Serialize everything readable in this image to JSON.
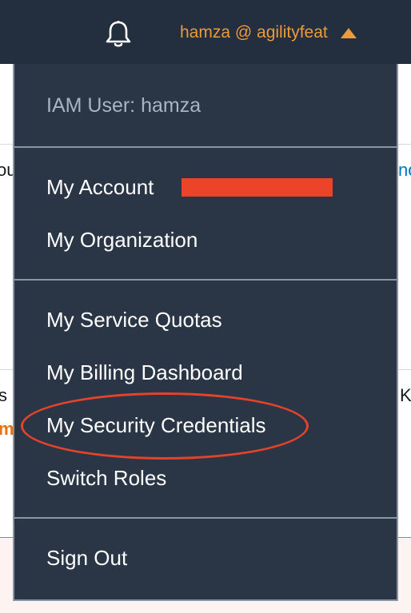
{
  "navbar": {
    "user_label": "hamza @ agilityfeat",
    "bell_icon": "bell-icon",
    "caret_icon": "caret-up-icon",
    "accent_color": "#ec9a3c",
    "background_color": "#232f3e"
  },
  "background_fragments": {
    "left_1": "ou",
    "right_1": "no",
    "left_2": "s",
    "right_2": "K",
    "left_orange": "m"
  },
  "dropdown": {
    "header": "IAM User: hamza",
    "items": [
      {
        "label": "My Account",
        "redacted": true
      },
      {
        "label": "My Organization"
      },
      {
        "label": "My Service Quotas"
      },
      {
        "label": "My Billing Dashboard"
      },
      {
        "label": "My Security Credentials",
        "highlighted": true
      },
      {
        "label": "Switch Roles"
      },
      {
        "label": "Sign Out"
      }
    ],
    "highlight_color": "#e4422a",
    "redaction_color": "#ec4428"
  }
}
